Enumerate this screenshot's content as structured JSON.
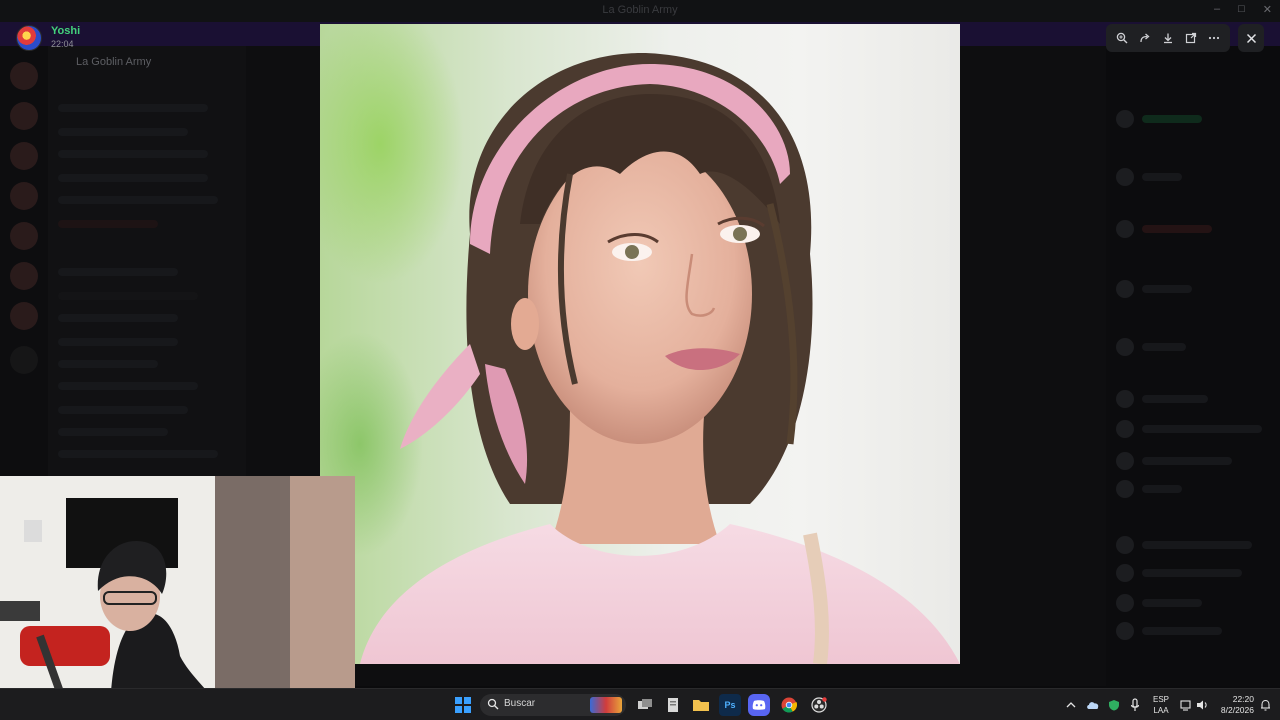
{
  "window": {
    "title": "La Goblin Army",
    "controls": [
      "minimize-icon",
      "maximize-icon",
      "close-icon"
    ]
  },
  "uploader": {
    "name": "Yoshi",
    "time": "22:04"
  },
  "viewer": {
    "tools": [
      {
        "name": "zoom-icon"
      },
      {
        "name": "forward-icon"
      },
      {
        "name": "download-icon"
      },
      {
        "name": "open-in-browser-icon"
      },
      {
        "name": "more-options-icon"
      }
    ],
    "close": "close-icon"
  },
  "background": {
    "server_name": "La Goblin Army"
  },
  "taskbar": {
    "search_placeholder": "Buscar",
    "apps": [
      "task-view-icon",
      "notes-icon",
      "file-explorer-icon",
      "photoshop-icon",
      "discord-icon",
      "chrome-icon",
      "obs-icon"
    ],
    "photoshop_label": "Ps",
    "language": {
      "line1": "ESP",
      "line2": "LAA"
    },
    "clock": {
      "time": "22:20",
      "date": "8/2/2026"
    }
  },
  "colors": {
    "accent_green": "#43d17c",
    "discord_blurple": "#5865f2",
    "purple_bar": "#1a1033"
  }
}
